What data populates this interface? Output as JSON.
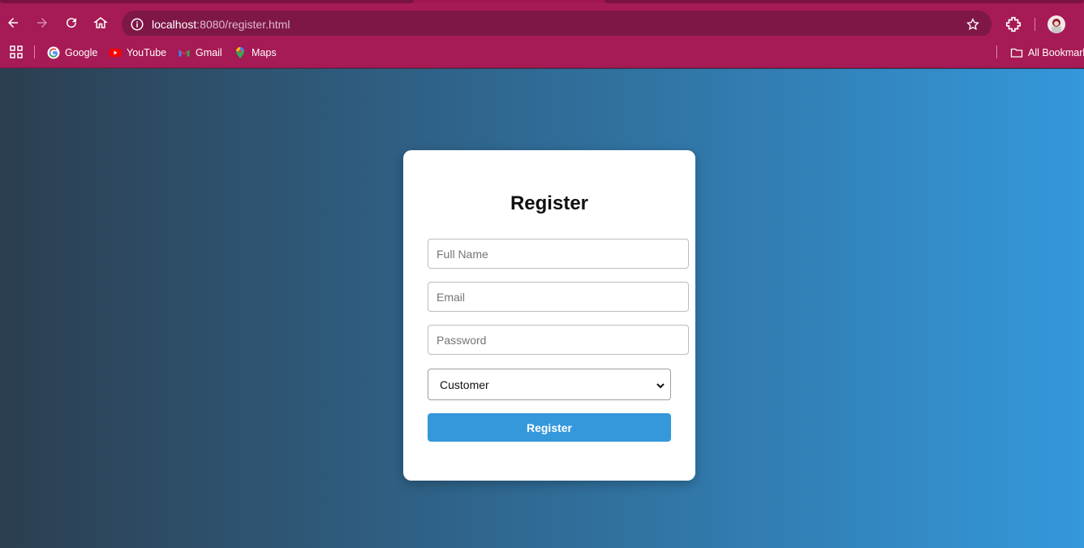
{
  "browser": {
    "url_host": "localhost",
    "url_rest": ":8080/register.html",
    "bookmarks": [
      {
        "label": "Google",
        "icon": "google-icon"
      },
      {
        "label": "YouTube",
        "icon": "youtube-icon"
      },
      {
        "label": "Gmail",
        "icon": "gmail-icon"
      },
      {
        "label": "Maps",
        "icon": "maps-icon"
      }
    ],
    "all_bookmarks_label": "All Bookmarks",
    "chrome_color": "#a61a55"
  },
  "form": {
    "title": "Register",
    "fullname_placeholder": "Full Name",
    "email_placeholder": "Email",
    "password_placeholder": "Password",
    "role_selected": "Customer",
    "submit_label": "Register",
    "accent_color": "#3498db",
    "gradient_from": "#2c3e50",
    "gradient_to": "#3498db"
  }
}
